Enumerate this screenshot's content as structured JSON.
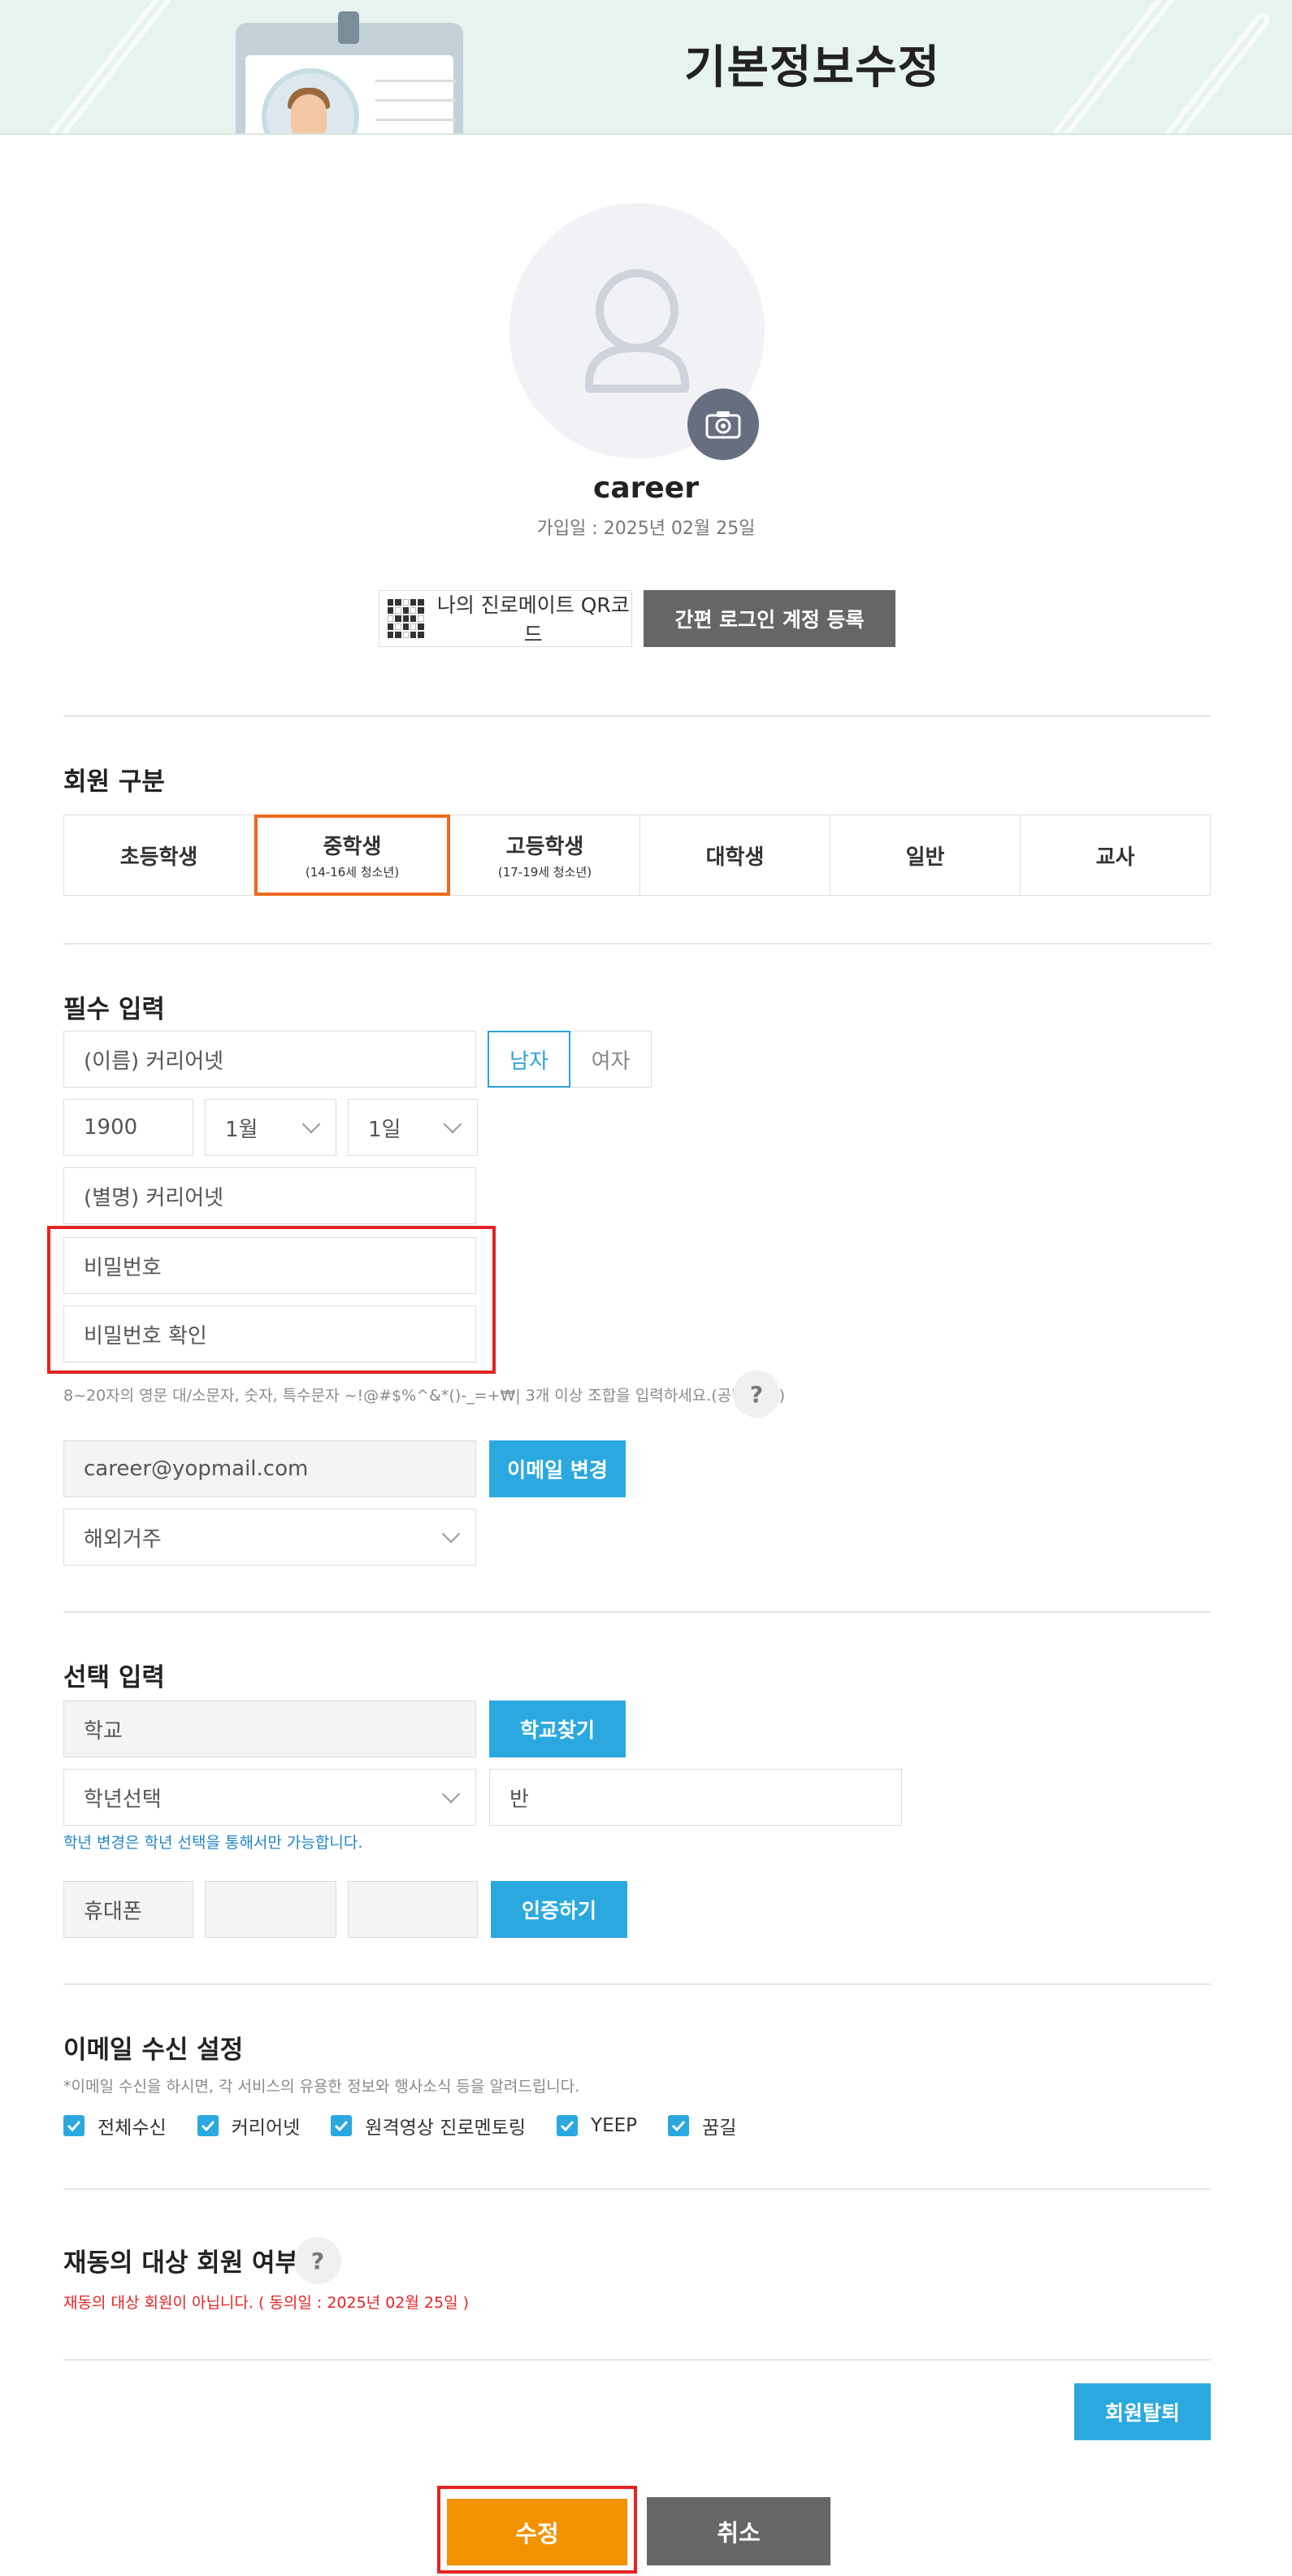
{
  "header": {
    "title": "기본정보수정"
  },
  "profile": {
    "username": "career",
    "join_date": "가입일 : 2025년 02월 25일",
    "qr_button_label": "나의 진로메이트 QR코드",
    "simple_login_label": "간편 로그인 계정 등록"
  },
  "member_type": {
    "title": "회원 구분",
    "items": [
      {
        "label": "초등학생",
        "sub": ""
      },
      {
        "label": "중학생",
        "sub": "(14-16세 청소년)"
      },
      {
        "label": "고등학생",
        "sub": "(17-19세 청소년)"
      },
      {
        "label": "대학생",
        "sub": ""
      },
      {
        "label": "일반",
        "sub": ""
      },
      {
        "label": "교사",
        "sub": ""
      }
    ],
    "selected": "중학생"
  },
  "required": {
    "title": "필수 입력",
    "name_value": "(이름) 커리어넷",
    "gender_male": "남자",
    "gender_female": "여자",
    "birth_year": "1900",
    "birth_month": "1월",
    "birth_day": "1일",
    "nickname_value": "(별명) 커리어넷",
    "password_placeholder": "비밀번호",
    "password_confirm_placeholder": "비밀번호 확인",
    "password_hint": "8~20자의 영문 대/소문자, 숫자, 특수문자 ~!@#$%^&*()-_=+₩| 3개 이상 조합을 입력하세요.(공백 불가)",
    "help_label": "?",
    "email_value": "career@yopmail.com",
    "email_change_label": "이메일 변경",
    "residence_value": "해외거주"
  },
  "optional": {
    "title": "선택 입력",
    "school_value": "학교",
    "find_school_label": "학교찾기",
    "grade_value": "학년선택",
    "class_value": "반",
    "grade_hint": "학년 변경은 학년 선택을 통해서만 가능합니다.",
    "phone_label": "휴대폰",
    "verify_label": "인증하기"
  },
  "email_settings": {
    "title": "이메일 수신 설정",
    "hint": "*이메일 수신을 하시면, 각 서비스의 유용한 정보와 행사소식 등을 알려드립니다.",
    "options": [
      "전체수신",
      "커리어넷",
      "원격영상 진로멘토링",
      "YEEP",
      "꿈길"
    ]
  },
  "consent": {
    "title": "재동의 대상 회원 여부",
    "help_label": "?",
    "message": "재동의 대상 회원이 아닙니다. ( 동의일 : 2025년 02월 25일 )"
  },
  "actions": {
    "withdraw_label": "회원탈퇴",
    "submit_label": "수정",
    "cancel_label": "취소"
  },
  "colors": {
    "accent_blue": "#2ba8e0",
    "accent_orange": "#f39200",
    "selected_border": "#ee6a1d",
    "highlight_red": "#e52323",
    "header_bg": "#e6f3ee"
  }
}
